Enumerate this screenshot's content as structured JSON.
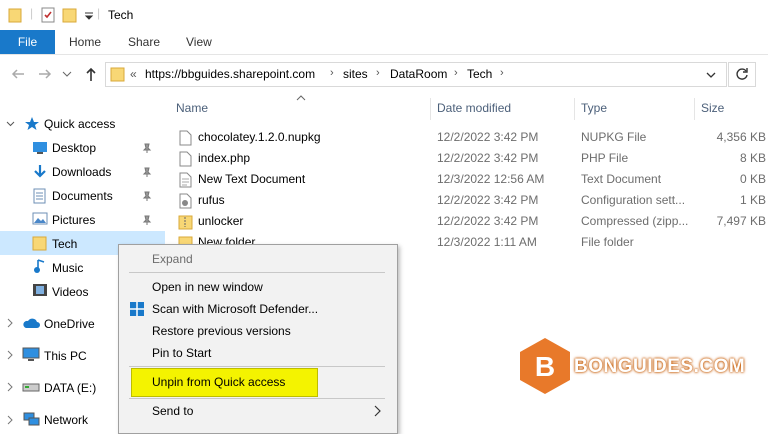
{
  "window": {
    "title": "Tech"
  },
  "ribbon": {
    "tabs": [
      "File",
      "Home",
      "Share",
      "View"
    ]
  },
  "address": {
    "prefix": "«",
    "crumbs": [
      "https://bbguides.sharepoint.com",
      "sites",
      "DataRoom",
      "Tech"
    ]
  },
  "nav": {
    "quick_access": "Quick access",
    "items": [
      {
        "label": "Desktop",
        "icon": "desktop-icon"
      },
      {
        "label": "Downloads",
        "icon": "downloads-icon"
      },
      {
        "label": "Documents",
        "icon": "documents-icon"
      },
      {
        "label": "Pictures",
        "icon": "pictures-icon"
      },
      {
        "label": "Tech",
        "icon": "folder-icon"
      },
      {
        "label": "Music",
        "icon": "music-icon"
      },
      {
        "label": "Videos",
        "icon": "videos-icon"
      }
    ],
    "onedrive": "OneDrive",
    "this_pc": "This PC",
    "data_drive": "DATA (E:)",
    "network": "Network"
  },
  "columns": {
    "name": "Name",
    "date": "Date modified",
    "type": "Type",
    "size": "Size"
  },
  "files": [
    {
      "name": "chocolatey.1.2.0.nupkg",
      "date": "12/2/2022 3:42 PM",
      "type": "NUPKG File",
      "size": "4,356 KB",
      "icon": "file-icon"
    },
    {
      "name": "index.php",
      "date": "12/2/2022 3:42 PM",
      "type": "PHP File",
      "size": "8 KB",
      "icon": "file-icon"
    },
    {
      "name": "New Text Document",
      "date": "12/3/2022 12:56 AM",
      "type": "Text Document",
      "size": "0 KB",
      "icon": "text-file-icon"
    },
    {
      "name": "rufus",
      "date": "12/2/2022 3:42 PM",
      "type": "Configuration sett...",
      "size": "1 KB",
      "icon": "gear-file-icon"
    },
    {
      "name": "unlocker",
      "date": "12/2/2022 3:42 PM",
      "type": "Compressed (zipp...",
      "size": "7,497 KB",
      "icon": "zip-folder-icon"
    },
    {
      "name": "New folder",
      "date": "12/3/2022 1:11 AM",
      "type": "File folder",
      "size": "",
      "icon": "folder-icon"
    }
  ],
  "context_menu": {
    "expand": "Expand",
    "open_new_window": "Open in new window",
    "scan": "Scan with Microsoft Defender...",
    "restore": "Restore previous versions",
    "pin_start": "Pin to Start",
    "unpin": "Unpin from Quick access",
    "send_to": "Send to"
  },
  "watermark": {
    "text": "BONGUIDES.COM",
    "letter": "B"
  },
  "colors": {
    "accent": "#1979ca",
    "highlight": "#f4f300",
    "logo": "#e8792a",
    "folder": "#f8d775"
  }
}
